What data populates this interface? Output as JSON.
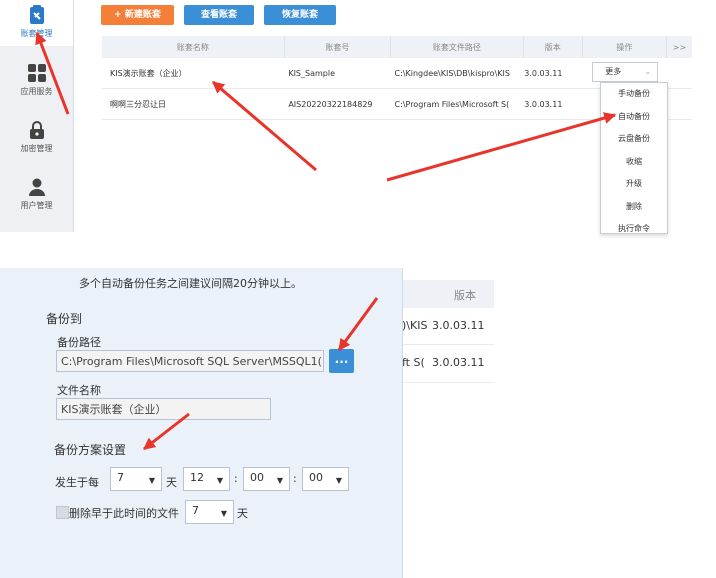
{
  "sidebar": {
    "items": [
      {
        "label": "账套管理",
        "icon": "accounts-icon"
      },
      {
        "label": "应用服务",
        "icon": "apps-grid-icon"
      },
      {
        "label": "加密管理",
        "icon": "lock-icon"
      },
      {
        "label": "用户管理",
        "icon": "user-icon"
      }
    ]
  },
  "toolbar": {
    "new_label": "+ 新建账套",
    "view_label": "查看账套",
    "restore_label": "恢复账套"
  },
  "table": {
    "headers": [
      "账套名称",
      "账套号",
      "账套文件路径",
      "版本",
      "操作"
    ],
    "expand": ">>",
    "rows": [
      {
        "name": "KIS演示账套（企业）",
        "code": "KIS_Sample",
        "path": "C:\\Kingdee\\KIS\\DB\\kispro\\KIS",
        "version": "3.0.03.11",
        "action": "更多"
      },
      {
        "name": "啊啊三分忍让日",
        "code": "AIS20220322184829",
        "path": "C:\\Program Files\\Microsoft S(",
        "version": "3.0.03.11",
        "action": ""
      }
    ]
  },
  "dropdown": {
    "items": [
      "手动备份",
      "自动备份",
      "云盘备份",
      "收缩",
      "升级",
      "删除",
      "执行命令"
    ]
  },
  "dialog": {
    "notice": "多个自动备份任务之间建议间隔20分钟以上。",
    "backup_to": "备份到",
    "path_label": "备份路径",
    "path_value": "C:\\Program Files\\Microsoft SQL Server\\MSSQL1(",
    "browse": "...",
    "filename_label": "文件名称",
    "filename_value": "KIS演示账套（企业）",
    "plan_title": "备份方案设置",
    "occurs_label": "发生于每",
    "days_value": "7",
    "day_unit": "天",
    "hour_value": "12",
    "colon": ":",
    "minute_value": "00",
    "second_value": "00",
    "delete_label": "删除早于此时间的文件",
    "delete_days": "7",
    "delete_unit": "天"
  },
  "background_table": {
    "header": "版本",
    "rows": [
      {
        "path_frag": ")\\KIS",
        "version": "3.0.03.11"
      },
      {
        "path_frag": "ft S(",
        "version": "3.0.03.11"
      }
    ]
  },
  "colors": {
    "accent_blue": "#3b8fd7",
    "accent_orange": "#f47f38",
    "annotation_red": "#e8342a"
  }
}
